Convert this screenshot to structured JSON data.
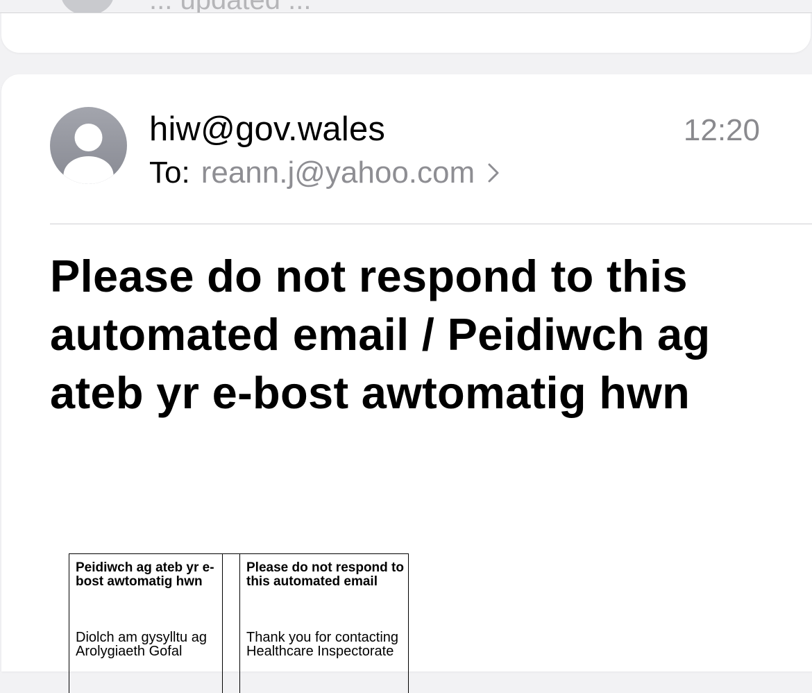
{
  "previous_message": {
    "snippet": "... updated ..."
  },
  "message": {
    "sender": "hiw@gov.wales",
    "time": "12:20",
    "to_label": "To:",
    "to_address": "reann.j@yahoo.com",
    "subject": "Please do not respond to this automated email / Peidiwch ag ateb yr e-bost awtomatig hwn"
  },
  "body_table": {
    "welsh": {
      "heading": "Peidiwch ag ateb yr e-bost awtomatig hwn",
      "text": "Diolch am gysylltu ag Arolygiaeth Gofal"
    },
    "english": {
      "heading": "Please do not respond to this automated email",
      "text": "Thank you for contacting Healthcare Inspectorate"
    }
  },
  "icons": {
    "avatar": "person-avatar-icon",
    "recipient_disclosure": "chevron-right-icon"
  },
  "colors": {
    "background": "#f2f2f4",
    "card": "#ffffff",
    "secondary_text": "#8e8e93",
    "avatar": "#9a9ca4"
  }
}
